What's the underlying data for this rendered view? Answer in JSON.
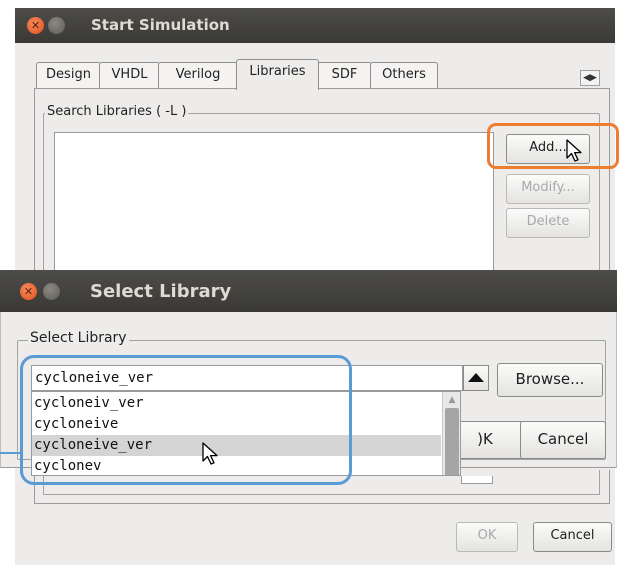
{
  "start_sim": {
    "title": "Start Simulation",
    "tabs": [
      {
        "label": "Design"
      },
      {
        "label": "VHDL"
      },
      {
        "label": "Verilog"
      },
      {
        "label": "Libraries"
      },
      {
        "label": "SDF"
      },
      {
        "label": "Others"
      }
    ],
    "search_group": "Search Libraries ( -L )",
    "add_label": "Add...",
    "modify_label": "Modify...",
    "delete_label": "Delete",
    "ok_label": "OK",
    "cancel_label": "Cancel"
  },
  "select_lib": {
    "title": "Select Library",
    "group_label": "Select Library",
    "input_value": "cycloneive_ver",
    "browse_label": "Browse...",
    "ok_label": "OK",
    "ok_partial": ")K",
    "cancel_label": "Cancel",
    "options": [
      "cycloneiv_ver",
      "cycloneive",
      "cycloneive_ver",
      "cyclonev"
    ],
    "selected_index": 2
  },
  "highlights": {
    "add_highlight_color": "#ed7d31",
    "dropdown_highlight_color": "#5b9bd5"
  }
}
